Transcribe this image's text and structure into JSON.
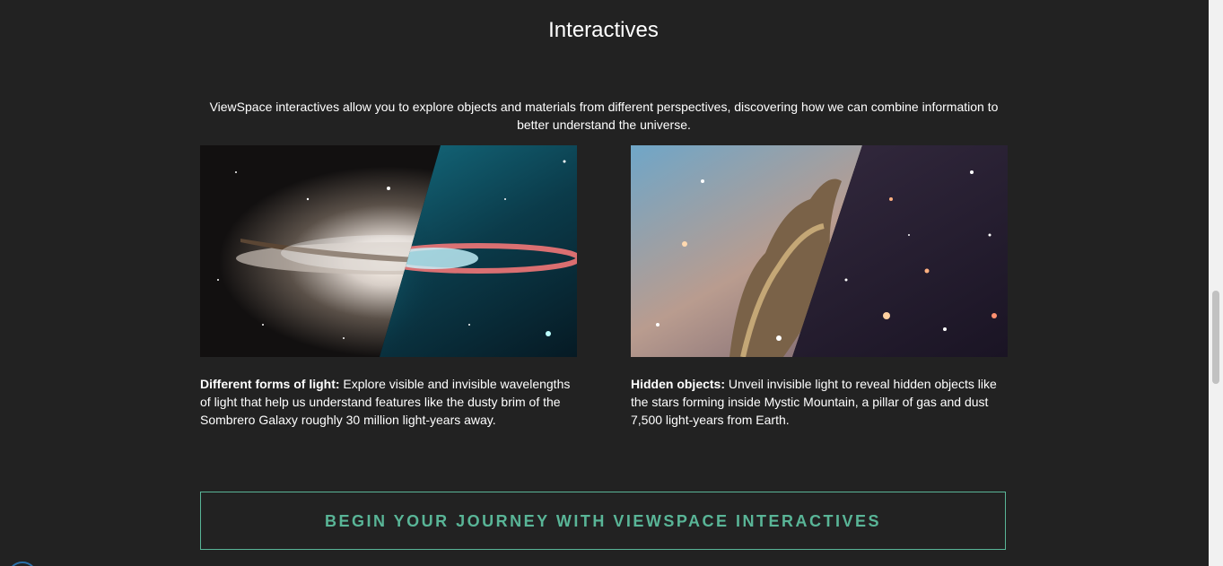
{
  "section": {
    "title": "Interactives",
    "intro": "ViewSpace interactives allow you to explore objects and materials from different perspectives, discovering how we can combine information to better understand the universe."
  },
  "cards": [
    {
      "image_alt": "Sombrero Galaxy in visible and infrared light",
      "heading": "Different forms of light:",
      "body": " Explore visible and invisible wavelengths of light that help us understand features like the dusty brim of the Sombrero Galaxy roughly 30 million light-years away."
    },
    {
      "image_alt": "Mystic Mountain in visible and infrared light",
      "heading": "Hidden objects:",
      "body": " Unveil invisible light to reveal hidden objects like the stars forming inside Mystic Mountain, a pillar of gas and dust 7,500 light-years from Earth."
    }
  ],
  "cta": {
    "label": "BEGIN YOUR JOURNEY WITH VIEWSPACE INTERACTIVES"
  },
  "colors": {
    "background": "#222222",
    "accent": "#59b597",
    "text": "#ffffff"
  }
}
